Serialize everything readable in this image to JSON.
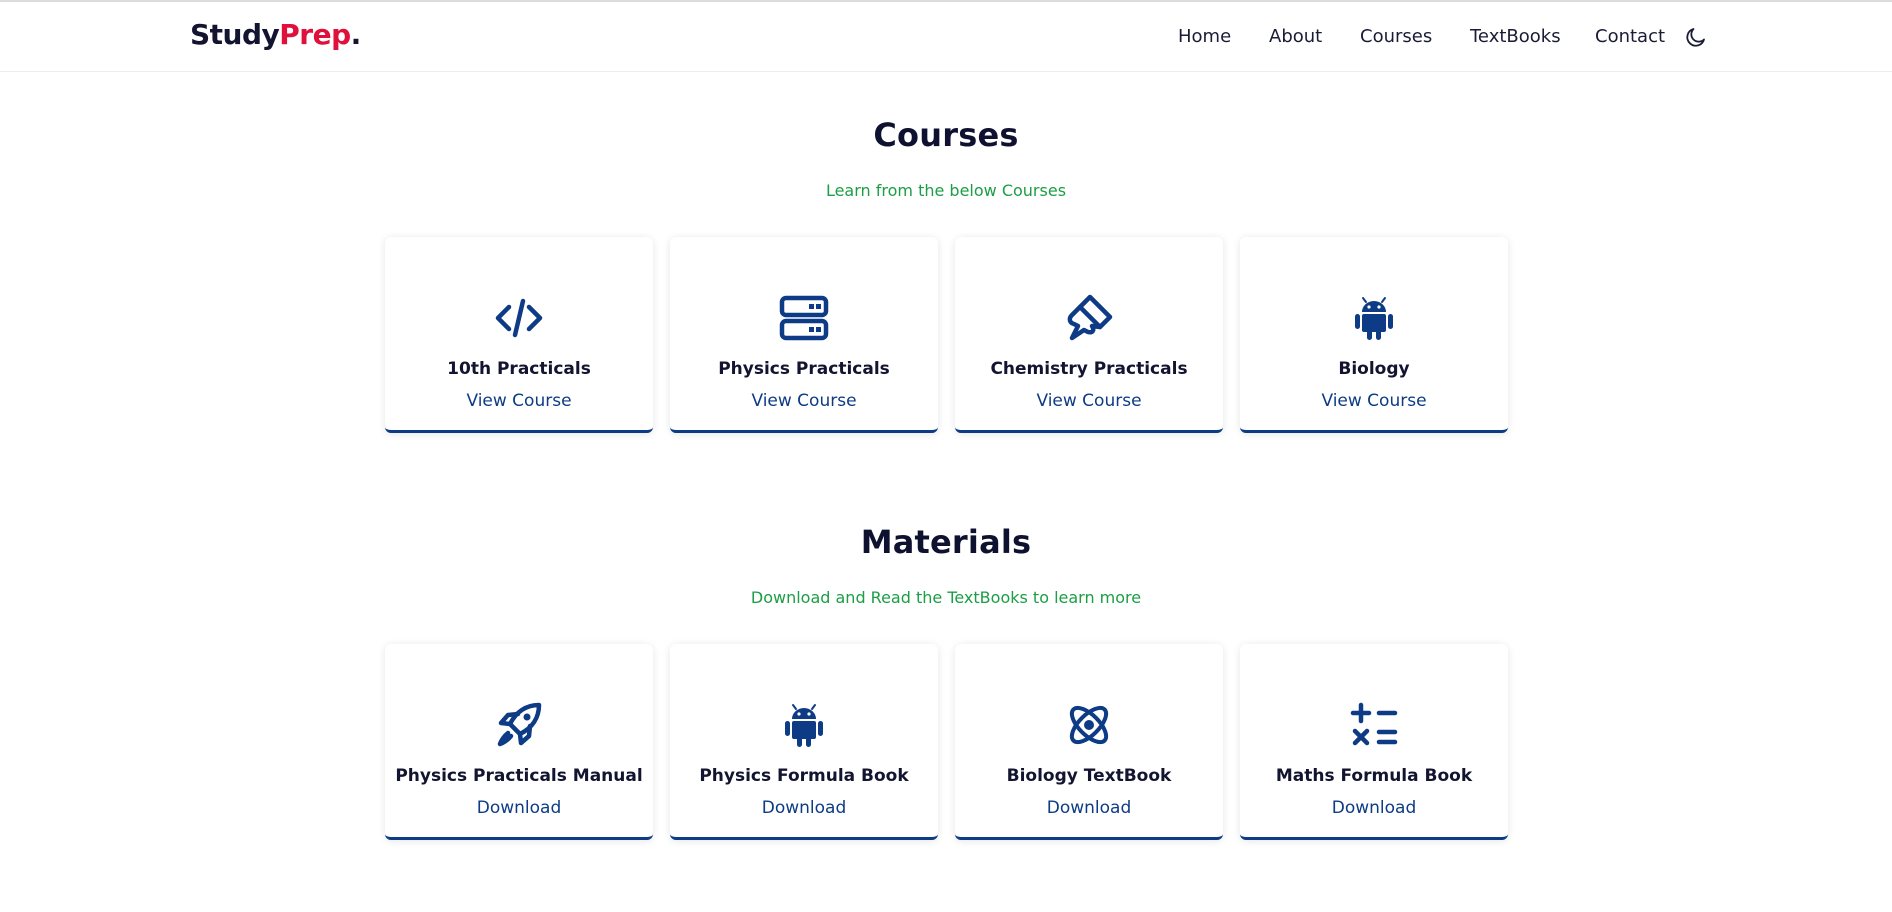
{
  "brand": {
    "part1": "Study",
    "part2": "Prep",
    "part3": "."
  },
  "nav": {
    "items": [
      "Home",
      "About",
      "Courses",
      "TextBooks",
      "Contact"
    ],
    "theme_icon": "moon-icon"
  },
  "colors": {
    "accent": "#0d3b85",
    "brand_red": "#e0103c",
    "subtitle_green": "#1b9e45",
    "heading": "#0f1130"
  },
  "courses": {
    "title": "Courses",
    "subtitle": "Learn from the below Courses",
    "cards": [
      {
        "icon": "code-icon",
        "title": "10th Practicals",
        "link": "View Course"
      },
      {
        "icon": "server-icon",
        "title": "Physics Practicals",
        "link": "View Course"
      },
      {
        "icon": "brush-icon",
        "title": "Chemistry Practicals",
        "link": "View Course"
      },
      {
        "icon": "android-icon",
        "title": "Biology",
        "link": "View Course"
      }
    ]
  },
  "materials": {
    "title": "Materials",
    "subtitle": "Download and Read the TextBooks to learn more",
    "cards": [
      {
        "icon": "rocket-icon",
        "title": "Physics Practicals Manual",
        "link": "Download"
      },
      {
        "icon": "android-icon",
        "title": "Physics Formula Book",
        "link": "Download"
      },
      {
        "icon": "atom-icon",
        "title": "Biology TextBook",
        "link": "Download"
      },
      {
        "icon": "calculator-icon",
        "title": "Maths Formula Book",
        "link": "Download"
      }
    ]
  }
}
